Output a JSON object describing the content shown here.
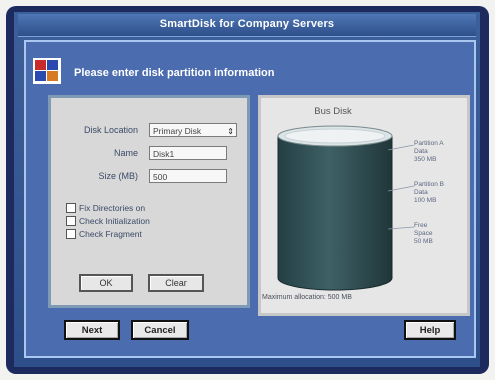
{
  "window": {
    "title": "SmartDisk for Company Servers"
  },
  "dialog": {
    "prompt": "Please enter disk partition information"
  },
  "form": {
    "disk_label": "Disk Location",
    "disk_value": "Primary Disk",
    "name_label": "Name",
    "name_value": "Disk1",
    "size_label": "Size (MB)",
    "size_value": "500",
    "checkboxes": [
      {
        "label": "Fix Directories on"
      },
      {
        "label": "Check Initialization"
      },
      {
        "label": "Check Fragment"
      }
    ],
    "ok_label": "OK",
    "clear_label": "Clear"
  },
  "preview": {
    "disk_title": "Bus Disk",
    "annotations": [
      {
        "lines": [
          "Partition A",
          "Data",
          "350 MB"
        ]
      },
      {
        "lines": [
          "Partition B",
          "Data",
          "100 MB"
        ]
      },
      {
        "lines": [
          "Free",
          "Space",
          "50 MB"
        ]
      }
    ],
    "footer": "Maximum allocation: 500 MB"
  },
  "buttons": {
    "next": "Next",
    "cancel": "Cancel",
    "help": "Help"
  },
  "colors": {
    "frame": "#1d2a5e",
    "dialog": "#4b6db0",
    "disk": "#2f4f54"
  },
  "icons": [
    "app-logo-icon",
    "dropdown-arrow-icon"
  ]
}
